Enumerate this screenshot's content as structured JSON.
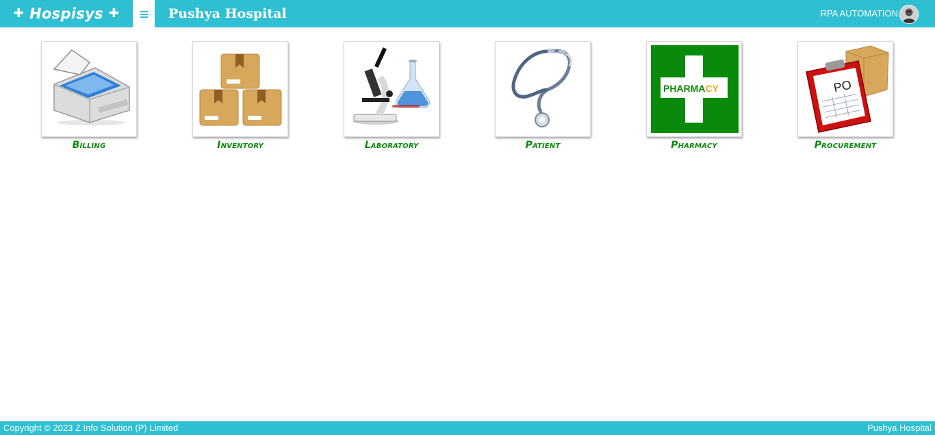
{
  "header": {
    "brand": "Hospisys",
    "hospital_name": "Pushya Hospital",
    "user_name": "RPA AUTOMATION"
  },
  "modules": [
    {
      "label": "Billing",
      "icon": "printer-icon"
    },
    {
      "label": "Inventory",
      "icon": "boxes-icon"
    },
    {
      "label": "Laboratory",
      "icon": "microscope-icon"
    },
    {
      "label": "Patient",
      "icon": "stethoscope-icon"
    },
    {
      "label": "Pharmacy",
      "icon": "pharmacy-cross-icon",
      "icon_text_a": "PHARMA",
      "icon_text_b": "CY"
    },
    {
      "label": "Procurement",
      "icon": "clipboard-po-icon",
      "icon_text": "PO"
    }
  ],
  "footer": {
    "copyright": "Copyright © 2023 Z Info Solution (P) Limited",
    "right_text": "Pushya Hospital"
  },
  "colors": {
    "header_bg": "#2fbfd2",
    "label_green": "#0c8a0c",
    "pharmacy_green": "#0a8a0a"
  }
}
